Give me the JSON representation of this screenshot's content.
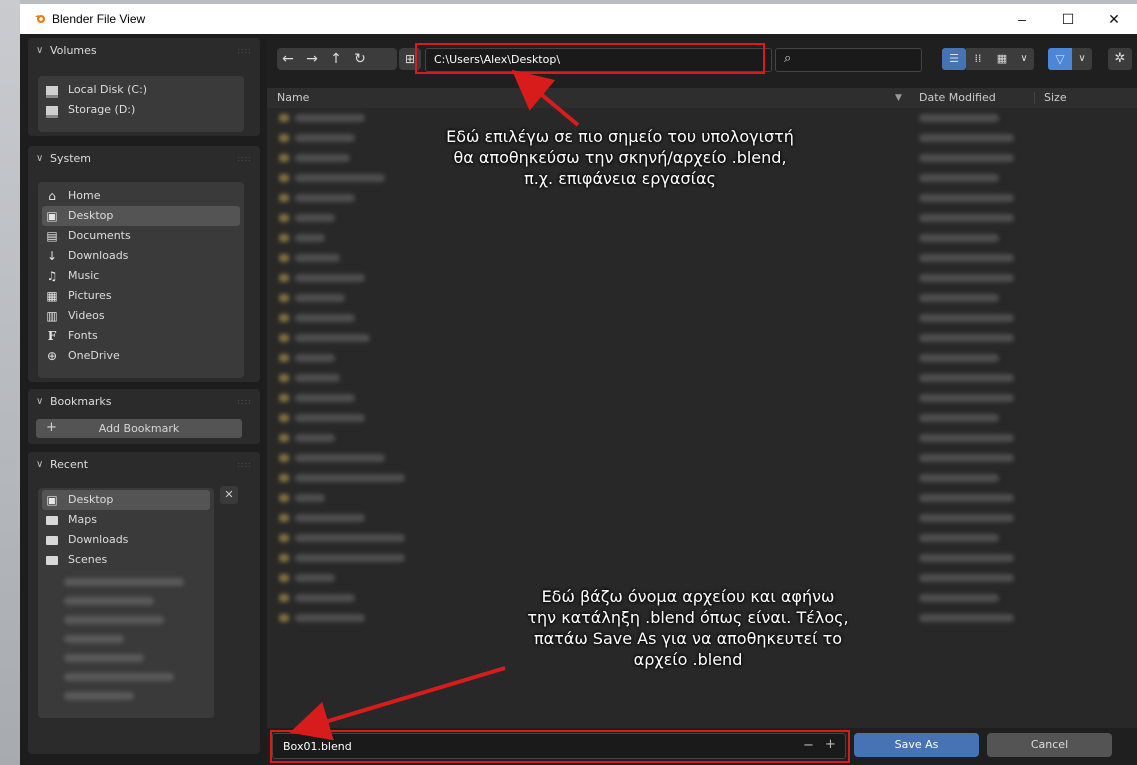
{
  "window": {
    "title": "Blender File View",
    "controls": [
      "–",
      "☐",
      "✕"
    ]
  },
  "sidebar": {
    "volumes": {
      "title": "Volumes",
      "items": [
        "Local Disk (C:)",
        "Storage (D:)"
      ]
    },
    "system": {
      "title": "System",
      "items": [
        "Home",
        "Desktop",
        "Documents",
        "Downloads",
        "Music",
        "Pictures",
        "Videos",
        "Fonts",
        "OneDrive"
      ],
      "selected": "Desktop"
    },
    "bookmarks": {
      "title": "Bookmarks",
      "add_label": "Add Bookmark",
      "add_icon": "+"
    },
    "recent": {
      "title": "Recent",
      "items": [
        "Desktop",
        "Maps",
        "Downloads",
        "Scenes"
      ],
      "selected": "Desktop"
    }
  },
  "toolbar": {
    "path": "C:\\Users\\Alex\\Desktop\\",
    "search_placeholder": ""
  },
  "columns": {
    "name": "Name",
    "date": "Date Modified",
    "size": "Size"
  },
  "bottom": {
    "filename": "Box01.blend",
    "minus": "−",
    "plus": "+",
    "save_label": "Save As",
    "cancel_label": "Cancel"
  },
  "annotations": {
    "top": [
      "Εδώ επιλέγω σε πιο σημείο του υπολογιστή",
      "θα αποθηκεύσω την σκηνή/αρχείο .blend,",
      "π.χ. επιφάνεια εργασίας"
    ],
    "bottom": [
      "Εδώ βάζω όνομα αρχείου και αφήνω",
      "την κατάληξη .blend όπως είναι. Τέλος,",
      "πατάω Save As για να αποθηκευτεί το",
      "αρχείο .blend"
    ]
  },
  "colors": {
    "accent": "#4772b3",
    "highlight": "#d81c1c",
    "filter": "#4c86d6"
  }
}
